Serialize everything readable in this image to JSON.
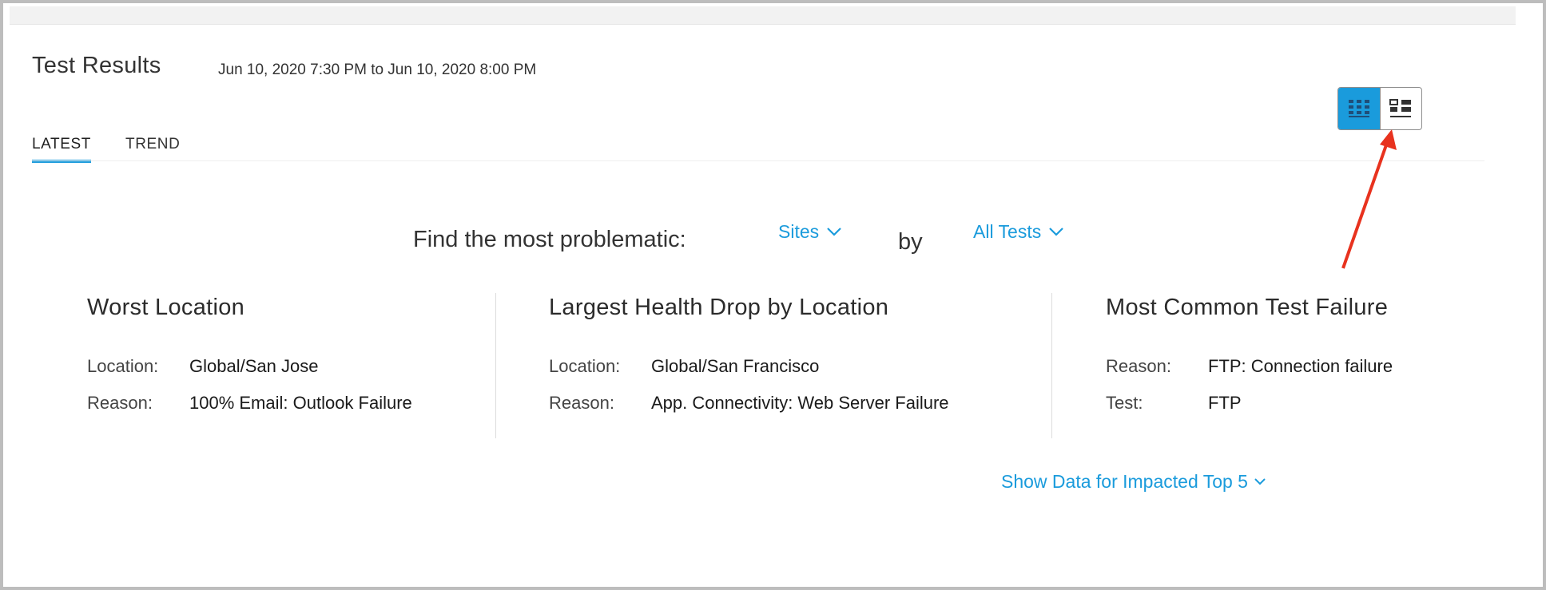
{
  "header": {
    "title": "Test Results",
    "time_range": "Jun 10, 2020 7:30 PM to Jun 10, 2020 8:00 PM"
  },
  "view_toggle": {
    "options": [
      {
        "icon": "grid-view-icon",
        "active": true
      },
      {
        "icon": "card-view-icon",
        "active": false
      }
    ]
  },
  "tabs": [
    {
      "label": "LATEST",
      "active": true
    },
    {
      "label": "TREND",
      "active": false
    }
  ],
  "filter": {
    "prompt": "Find the most problematic:",
    "entity": "Sites",
    "connector": "by",
    "test": "All Tests"
  },
  "cards": [
    {
      "title": "Worst Location",
      "rows": [
        {
          "label": "Location:",
          "value": "Global/San Jose"
        },
        {
          "label": "Reason:",
          "value": "100% Email: Outlook Failure"
        }
      ]
    },
    {
      "title": "Largest Health Drop by Location",
      "rows": [
        {
          "label": "Location:",
          "value": "Global/San Francisco"
        },
        {
          "label": "Reason:",
          "value": "App. Connectivity: Web Server Failure"
        }
      ]
    },
    {
      "title": "Most Common Test Failure",
      "rows": [
        {
          "label": "Reason:",
          "value": "FTP: Connection failure"
        },
        {
          "label": "Test:",
          "value": "FTP"
        }
      ]
    }
  ],
  "show_more": {
    "label": "Show Data for Impacted Top 5"
  },
  "colors": {
    "accent": "#1a9bdc",
    "annotation_arrow": "#e8321e"
  }
}
